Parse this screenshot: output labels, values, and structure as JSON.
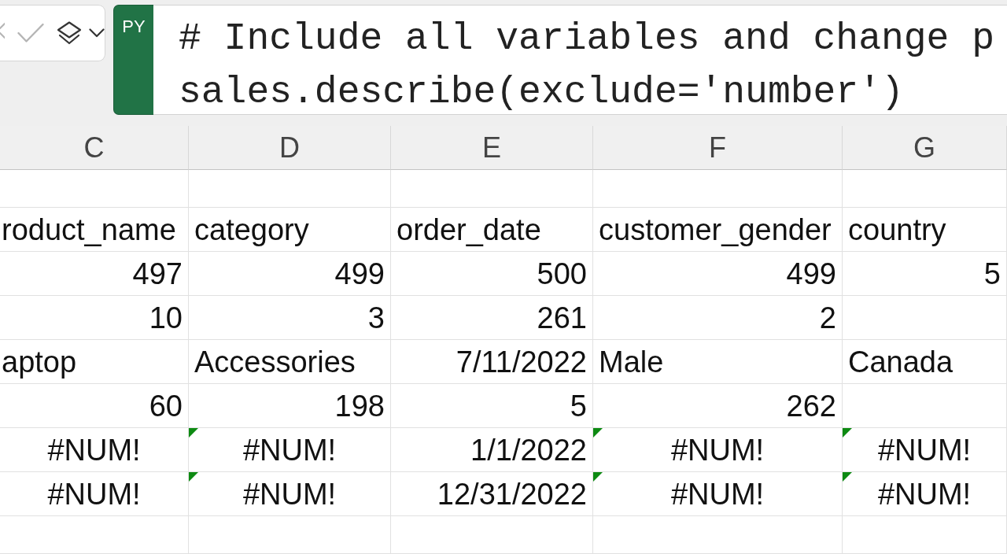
{
  "toolbar": {
    "edit_buttons_disabled": true
  },
  "formula_bar": {
    "language_badge": "PY",
    "code_lines": [
      "# Include all variables and change p",
      "sales.describe(exclude='number')"
    ]
  },
  "columns": [
    "C",
    "D",
    "E",
    "F",
    "G"
  ],
  "rows": [
    {
      "cells": [
        {
          "kind": "text",
          "text": "roduct_name",
          "error_flag": false
        },
        {
          "kind": "text",
          "text": "category",
          "error_flag": false
        },
        {
          "kind": "text",
          "text": "order_date",
          "error_flag": false
        },
        {
          "kind": "text",
          "text": "customer_gender",
          "error_flag": false
        },
        {
          "kind": "text",
          "text": "country",
          "error_flag": false
        }
      ]
    },
    {
      "cells": [
        {
          "kind": "number",
          "text": "497",
          "error_flag": false
        },
        {
          "kind": "number",
          "text": "499",
          "error_flag": false
        },
        {
          "kind": "number",
          "text": "500",
          "error_flag": false
        },
        {
          "kind": "number",
          "text": "499",
          "error_flag": false
        },
        {
          "kind": "number",
          "text": "5",
          "error_flag": false
        }
      ]
    },
    {
      "cells": [
        {
          "kind": "number",
          "text": "10",
          "error_flag": false
        },
        {
          "kind": "number",
          "text": "3",
          "error_flag": false
        },
        {
          "kind": "number",
          "text": "261",
          "error_flag": false
        },
        {
          "kind": "number",
          "text": "2",
          "error_flag": false
        },
        {
          "kind": "number",
          "error_flag": false
        }
      ]
    },
    {
      "cells": [
        {
          "kind": "text",
          "text": "aptop",
          "error_flag": false
        },
        {
          "kind": "text",
          "text": "Accessories",
          "error_flag": false
        },
        {
          "kind": "number",
          "text": "7/11/2022",
          "error_flag": false
        },
        {
          "kind": "text",
          "text": "Male",
          "error_flag": false
        },
        {
          "kind": "text",
          "text": "Canada",
          "error_flag": false
        }
      ]
    },
    {
      "cells": [
        {
          "kind": "number",
          "text": "60",
          "error_flag": false
        },
        {
          "kind": "number",
          "text": "198",
          "error_flag": false
        },
        {
          "kind": "number",
          "text": "5",
          "error_flag": false
        },
        {
          "kind": "number",
          "text": "262",
          "error_flag": false
        },
        {
          "kind": "number",
          "error_flag": false
        }
      ]
    },
    {
      "cells": [
        {
          "kind": "error",
          "text": "#NUM!",
          "error_flag": false
        },
        {
          "kind": "error",
          "text": "#NUM!",
          "error_flag": true
        },
        {
          "kind": "number",
          "text": "1/1/2022",
          "error_flag": false
        },
        {
          "kind": "error",
          "text": "#NUM!",
          "error_flag": true
        },
        {
          "kind": "error",
          "text": "#NUM!",
          "error_flag": true
        }
      ]
    },
    {
      "cells": [
        {
          "kind": "error",
          "text": "#NUM!",
          "error_flag": false
        },
        {
          "kind": "error",
          "text": "#NUM!",
          "error_flag": true
        },
        {
          "kind": "number",
          "text": "12/31/2022",
          "error_flag": false
        },
        {
          "kind": "error",
          "text": "#NUM!",
          "error_flag": true
        },
        {
          "kind": "error",
          "text": "#NUM!",
          "error_flag": true
        }
      ]
    }
  ]
}
